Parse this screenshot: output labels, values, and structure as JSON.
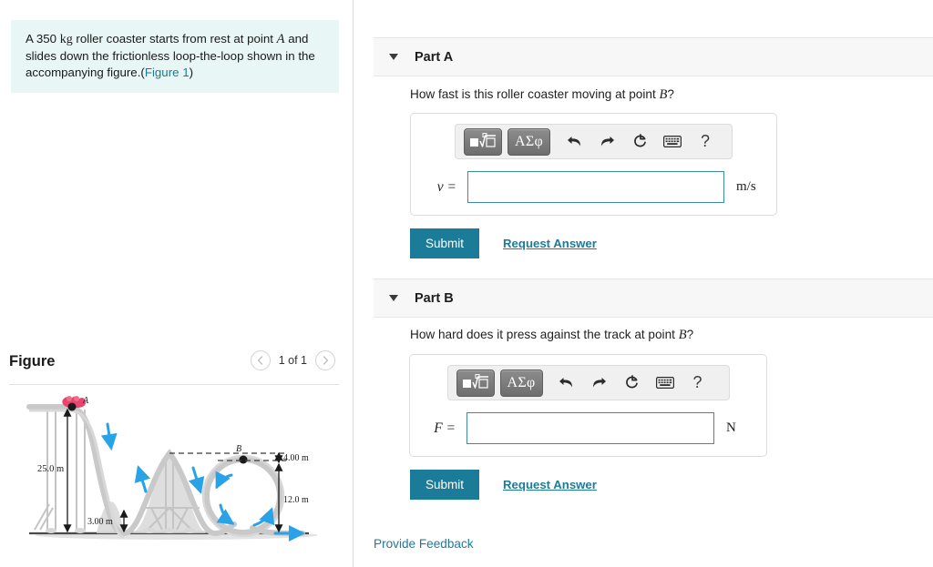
{
  "problem": {
    "text_before_mass": "A ",
    "mass": "350",
    "mass_unit": "kg",
    "text_mid": " roller coaster starts from rest at point ",
    "point_a": "A",
    "text_after": " and slides down the frictionless loop-the-loop shown in the accompanying figure.(",
    "figure_link": "Figure 1",
    "text_end": ")"
  },
  "figure": {
    "title": "Figure",
    "count_label": "1 of 1",
    "prev_icon": "chevron-left-icon",
    "next_icon": "chevron-right-icon",
    "labels": {
      "point_a": "A",
      "point_b": "B",
      "height_total": "25.0 m",
      "height_valley": "3.00 m",
      "loop_top_gap": "4.00 m",
      "loop_height": "12.0 m"
    }
  },
  "parts": [
    {
      "header": "Part A",
      "caret_icon": "caret-down-icon",
      "question_prefix": "How fast is this roller coaster moving at point ",
      "question_var": "B",
      "question_suffix": "?",
      "variable": "v =",
      "value": "",
      "unit": "m/s",
      "submit_label": "Submit",
      "request_label": "Request Answer"
    },
    {
      "header": "Part B",
      "caret_icon": "caret-down-icon",
      "question_prefix": "How hard does it press against the track at point ",
      "question_var": "B",
      "question_suffix": "?",
      "variable": "F =",
      "value": "",
      "unit": "N",
      "submit_label": "Submit",
      "request_label": "Request Answer"
    }
  ],
  "toolbar": {
    "template_icon": "math-template-icon",
    "greek_label": "ΑΣφ",
    "undo_icon": "undo-arrow-icon",
    "redo_icon": "redo-arrow-icon",
    "reset_icon": "reset-circular-arrow-icon",
    "keyboard_icon": "keyboard-icon",
    "help_label": "?"
  },
  "footer": {
    "feedback_label": "Provide Feedback"
  },
  "colors": {
    "accent_teal": "#1b7c99",
    "problem_bg": "#e8f6f5",
    "input_border": "#3c8aa8",
    "part_header_bg": "#f7f7f7",
    "arrow_blue": "#29a3e8",
    "car_red": "#e8446d"
  }
}
